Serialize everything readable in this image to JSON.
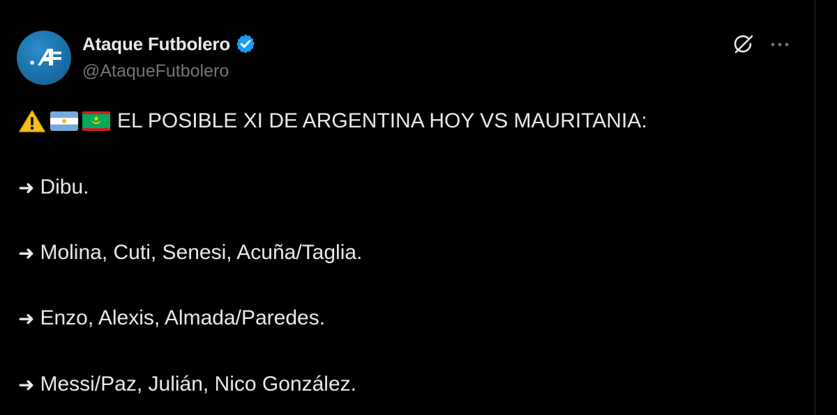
{
  "account": {
    "display_name": "Ataque Futbolero",
    "handle": "@AtaqueFutbolero",
    "verified": true,
    "avatar_text": "A"
  },
  "actions": {
    "grok_icon": "grok-icon",
    "more_icon": "more-icon",
    "more_label": "···"
  },
  "post": {
    "title_line": "EL POSIBLE XI DE ARGENTINA HOY VS MAURITANIA:",
    "emojis": [
      "warning-icon",
      "argentina-flag-icon",
      "mauritania-flag-icon"
    ],
    "arrow": "➜",
    "lines": [
      "Dibu.",
      "Molina, Cuti, Senesi, Acuña/Taglia.",
      "Enzo, Alexis, Almada/Paredes.",
      "Messi/Paz, Julián, Nico González."
    ]
  },
  "colors": {
    "background": "#000000",
    "text": "#e7e9ea",
    "secondary_text": "#71767b",
    "verified_blue": "#1d9bf0",
    "avatar_blue": "#1b6fa8"
  }
}
